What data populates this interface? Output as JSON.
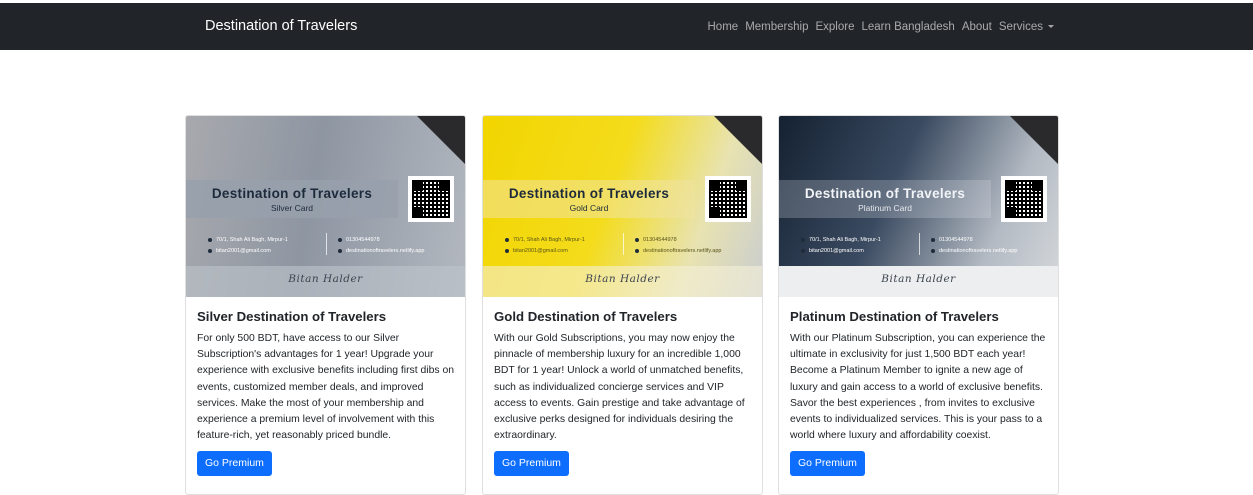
{
  "navbar": {
    "brand": "Destination of Travelers",
    "links": [
      "Home",
      "Membership",
      "Explore",
      "Learn Bangladesh",
      "About",
      "Services"
    ]
  },
  "cards": [
    {
      "art": {
        "title": "Destination of Travelers",
        "subtitle": "Silver Card",
        "address": "70/1, Shah Ali Bagh, Mirpur-1",
        "email": "bitan2001@gmail.com",
        "phone": "01304544978",
        "website": "destinationoftravelers.netlify.app",
        "name": "Bitan Halder"
      },
      "title": "Silver Destination of Travelers",
      "text": "For only 500 BDT, have access to our Silver Subscription's advantages for 1 year! Upgrade your experience with exclusive benefits including first dibs on events, customized member deals, and improved services. Make the most of your membership and experience a premium level of involvement with this feature-rich, yet reasonably priced bundle.",
      "button": "Go Premium"
    },
    {
      "art": {
        "title": "Destination of Travelers",
        "subtitle": "Gold Card",
        "address": "70/1, Shah Ali Bagh, Mirpur-1",
        "email": "bitan2001@gmail.com",
        "phone": "01304544978",
        "website": "destinationoftravelers.netlify.app",
        "name": "Bitan Halder"
      },
      "title": "Gold Destination of Travelers",
      "text": "With our Gold Subscriptions, you may now enjoy the pinnacle of membership luxury for an incredible 1,000 BDT for 1 year! Unlock a world of unmatched benefits, such as individualized concierge services and VIP access to events. Gain prestige and take advantage of exclusive perks designed for individuals desiring the extraordinary.",
      "button": "Go Premium"
    },
    {
      "art": {
        "title": "Destination of Travelers",
        "subtitle": "Platinum Card",
        "address": "70/1, Shah Ali Bagh, Mirpur-1",
        "email": "bitan2001@gmail.com",
        "phone": "01304544978",
        "website": "destinationoftravelers.netlify.app",
        "name": "Bitan Halder"
      },
      "title": "Platinum Destination of Travelers",
      "text": "With our Platinum Subscription, you can experience the ultimate in exclusivity for just 1,500 BDT each year! Become a Platinum Member to ignite a new age of luxury and gain access to a world of exclusive benefits. Savor the best experiences , from invites to exclusive events to individualized services. This is your pass to a world where luxury and affordability coexist.",
      "button": "Go Premium"
    }
  ],
  "colors": {
    "navbar": "#212529",
    "button": "#0d6efd"
  },
  "icons": [
    "map-pin-icon",
    "email-icon",
    "phone-icon",
    "globe-icon",
    "dropdown-caret-icon"
  ]
}
